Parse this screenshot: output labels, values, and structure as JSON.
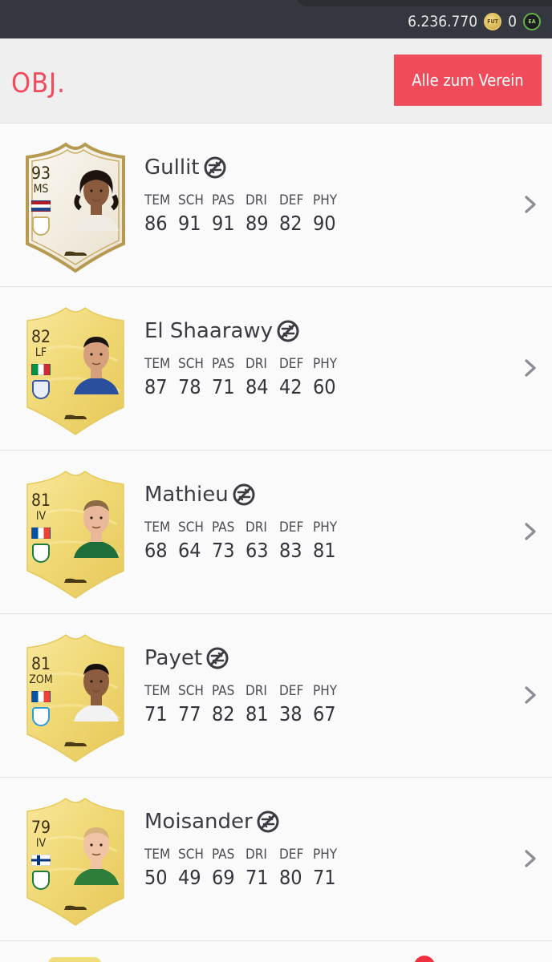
{
  "topbar": {
    "coins": "6.236.770",
    "coin_icon": "FUT",
    "points": "0",
    "points_icon": "EA"
  },
  "header": {
    "title": "OBJ.",
    "send_all_label": "Alle zum Verein"
  },
  "stat_labels": [
    "TEM",
    "SCH",
    "PAS",
    "DRI",
    "DEF",
    "PHY"
  ],
  "colors": {
    "accent": "#f04b5a",
    "gold_card": "#f1dc7a",
    "icon_card": "#f3eee3",
    "text_dark": "#3b3b44"
  },
  "players": [
    {
      "name": "Gullit",
      "rating": "93",
      "position": "MS",
      "card_type": "icon",
      "flag": "nl",
      "stats": [
        "86",
        "91",
        "91",
        "89",
        "82",
        "90"
      ]
    },
    {
      "name": "El Shaarawy",
      "rating": "82",
      "position": "LF",
      "card_type": "gold",
      "flag": "it",
      "stats": [
        "87",
        "78",
        "71",
        "84",
        "42",
        "60"
      ]
    },
    {
      "name": "Mathieu",
      "rating": "81",
      "position": "IV",
      "card_type": "gold",
      "flag": "fr",
      "stats": [
        "68",
        "64",
        "73",
        "63",
        "83",
        "81"
      ]
    },
    {
      "name": "Payet",
      "rating": "81",
      "position": "ZOM",
      "card_type": "gold",
      "flag": "fr",
      "stats": [
        "71",
        "77",
        "82",
        "81",
        "38",
        "67"
      ]
    },
    {
      "name": "Moisander",
      "rating": "79",
      "position": "IV",
      "card_type": "gold",
      "flag": "fi",
      "stats": [
        "50",
        "49",
        "69",
        "71",
        "80",
        "71"
      ]
    }
  ]
}
